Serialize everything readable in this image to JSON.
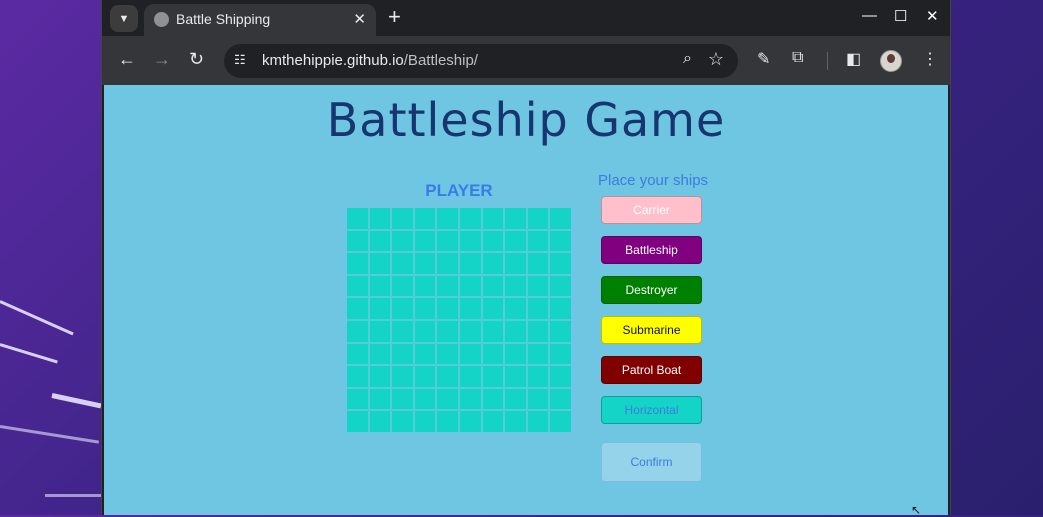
{
  "browser": {
    "tab_title": "Battle Shipping",
    "new_tab": "+",
    "url_host": "kmthehippie.github.io",
    "url_path": "/Battleship/",
    "controls": {
      "minimize": "—",
      "maximize": "☐",
      "close": "✕"
    }
  },
  "game": {
    "title": "Battleship Game",
    "player_label": "PLAYER",
    "place_label": "Place your ships",
    "grid_size": 10,
    "ships": [
      {
        "label": "Carrier",
        "bg": "#ffc0cb",
        "fg": "#ffffff"
      },
      {
        "label": "Battleship",
        "bg": "#800080",
        "fg": "#ffffff"
      },
      {
        "label": "Destroyer",
        "bg": "#008000",
        "fg": "#ffffff"
      },
      {
        "label": "Submarine",
        "bg": "#ffff00",
        "fg": "#111111"
      },
      {
        "label": "Patrol Boat",
        "bg": "#800000",
        "fg": "#ffffff"
      }
    ],
    "orientation_label": "Horizontal",
    "orientation_bg": "#14d4c8",
    "confirm_label": "Confirm"
  },
  "colors": {
    "page_bg": "#6ec6e2",
    "title": "#17356e",
    "accent": "#3a7bea",
    "cell": "#14d4c8"
  }
}
